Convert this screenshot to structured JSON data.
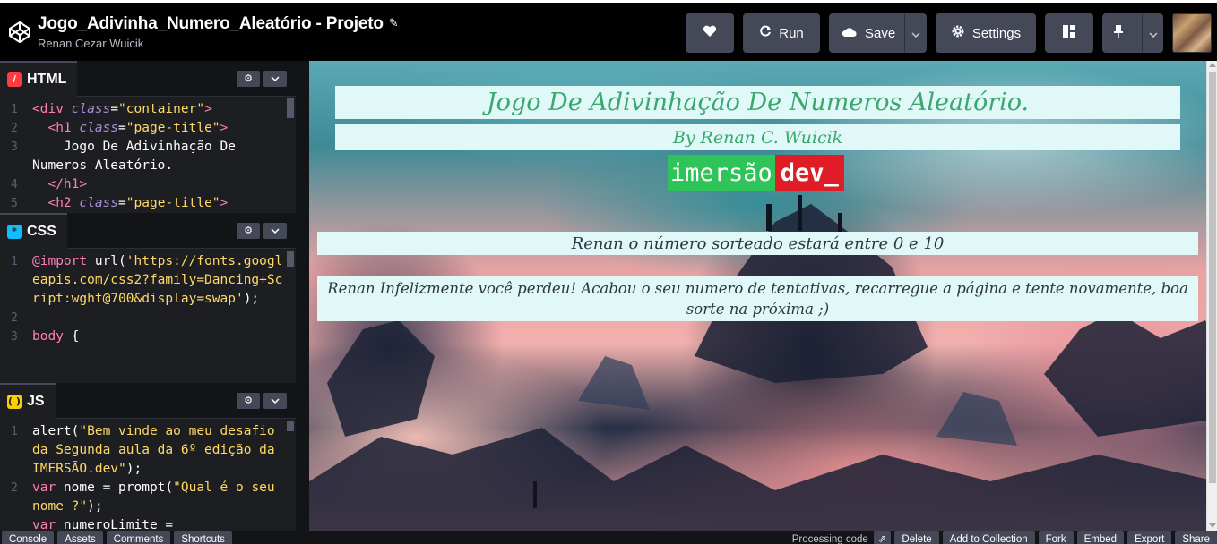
{
  "header": {
    "project_title": "Jogo_Adivinha_Numero_Aleatório - Projeto",
    "author": "Renan Cezar Wuicik",
    "run_label": "Run",
    "save_label": "Save",
    "settings_label": "Settings"
  },
  "editors": {
    "html": {
      "label": "HTML",
      "lines": [
        {
          "n": "1",
          "text": ""
        },
        {
          "n": "2",
          "text": ""
        },
        {
          "n": "3",
          "text": "    Jogo De Adivinhação De Numeros Aleatório."
        },
        {
          "n": "4",
          "text": ""
        },
        {
          "n": "5",
          "text": ""
        }
      ]
    },
    "css": {
      "label": "CSS",
      "lines": [
        {
          "n": "1",
          "text": ""
        },
        {
          "n": "2",
          "text": ""
        },
        {
          "n": "3",
          "text": ""
        }
      ]
    },
    "js": {
      "label": "JS",
      "lines": [
        {
          "n": "1",
          "text": ""
        },
        {
          "n": "2",
          "text": ""
        }
      ]
    }
  },
  "code_tokens": {
    "html_l1_open": "<div ",
    "html_l1_attr": "class",
    "html_l1_eq": "=",
    "html_l1_val": "\"container\"",
    "html_l1_close": ">",
    "html_l2_open": "<h1 ",
    "html_l2_attr": "class",
    "html_l2_eq": "=",
    "html_l2_val": "\"page-title\"",
    "html_l2_close": ">",
    "html_l4": "</h1>",
    "html_l5_open": "<h2 ",
    "html_l5_attr": "class",
    "html_l5_eq": "=",
    "html_l5_val": "\"page-title\"",
    "html_l5_close": ">",
    "css_l1_kw": "@import",
    "css_l1_fn": "url(",
    "css_l1_str": "'https://fonts.googleapis.com/css2?family=Dancing+Script:wght@700&display=swap'",
    "css_l1_end": ");",
    "css_l3_sel": "body",
    "css_l3_brace": " {",
    "js_l1_fn": "alert(",
    "js_l1_str": "\"Bem vinde ao meu desafio da Segunda aula da 6º edição da IMERSÃO.dev\"",
    "js_l1_end": ");",
    "js_l2_kw": "var ",
    "js_l2_var": "nome = ",
    "js_l2_fn": "prompt(",
    "js_l2_str": "\"Qual é o seu nome ?\"",
    "js_l2_end": ");",
    "js_l3_kw": "var ",
    "js_l3_var": "numeroLimite ="
  },
  "preview": {
    "title": "Jogo De Adivinhação De Numeros Aleatório.",
    "subtitle": "By Renan C. Wuicik",
    "logo_part1": "imersão",
    "logo_part2": "dev_",
    "range_text": "Renan o número sorteado estará entre 0 e 10",
    "result_text": "Renan Infelizmente você perdeu! Acabou o seu numero de tentativas, recarregue a página e tente novamente, boa sorte na próxima ;)"
  },
  "footer": {
    "console": "Console",
    "assets": "Assets",
    "comments": "Comments",
    "shortcuts": "Shortcuts",
    "processing": "Processing code",
    "delete": "Delete",
    "add_to_collection": "Add to Collection",
    "fork": "Fork",
    "embed": "Embed",
    "export": "Export",
    "share": "Share"
  },
  "colors": {
    "title_green": "#3aa86e",
    "banner_bg": "#e0f8f8",
    "imersao_green": "#2fc45a",
    "imersao_red": "#e01d26",
    "header_bg": "#010101",
    "button_bg": "#444857"
  },
  "icons": {
    "logo": "codepen-cube-icon",
    "heart": "heart-icon",
    "run": "refresh-icon",
    "save": "cloud-icon",
    "settings": "gear-icon",
    "layout": "layout-icon",
    "pin": "pin-icon"
  }
}
